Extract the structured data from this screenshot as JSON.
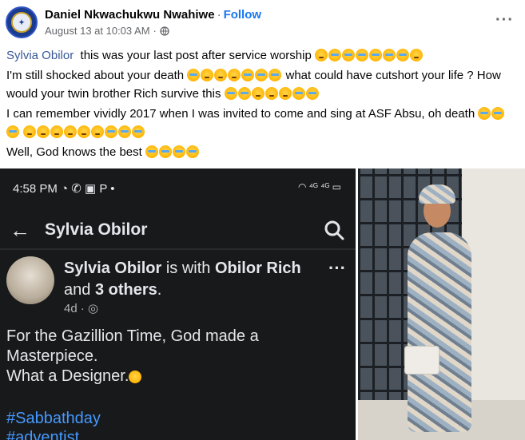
{
  "header": {
    "author": "Daniel Nkwachukwu Nwahiwe",
    "separator": "·",
    "follow_label": "Follow",
    "timestamp": "August 13 at 10:03 AM",
    "meta_separator": "·",
    "audience_icon": "globe-icon",
    "more_icon": "more-options-icon"
  },
  "post": {
    "line1_mention": "Sylvia Obilor",
    "line1_text": "this was your last post after service worship",
    "line2_text_a": "I'm still shocked about your death",
    "line2_text_b": "what could have cutshort your life ? How would your twin brother Rich survive this",
    "line3_text": "I can remember vividly 2017 when I was invited to come and sing at ASF Absu, oh death",
    "line4_text": "Well, God knows the best"
  },
  "screenshot": {
    "status_time": "4:58 PM",
    "status_icons": "◔ ✆ ▣ P •",
    "status_right": "◠ ⁴ᴳ ⁴ᴳ ▭",
    "nav_title": "Sylvia Obilor",
    "post_author": "Sylvia Obilor",
    "post_with": "is with",
    "post_tagged": "Obilor Rich",
    "post_and": "and",
    "post_others": "3 others",
    "post_period": ".",
    "post_age": "4d ·",
    "post_text_line1": "For the Gazillion Time, God made a",
    "post_text_line2": "Masterpiece.",
    "post_text_line3": "What a Designer.",
    "hashtag1": "#Sabbathday",
    "hashtag2": "#adventist"
  },
  "colors": {
    "link_blue": "#1877f2",
    "mention": "#385898",
    "dark_bg": "#18191a",
    "hashtag": "#4599ff"
  }
}
